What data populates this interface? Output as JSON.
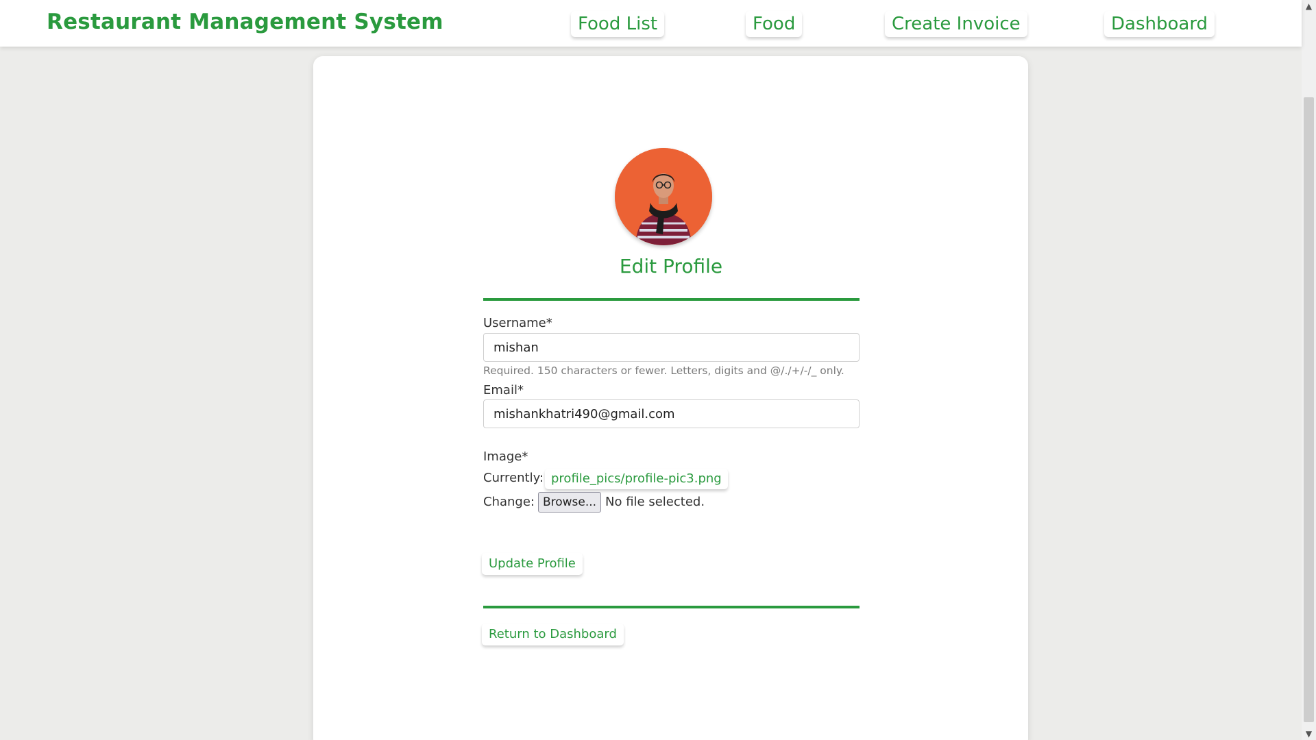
{
  "app": {
    "brand": "Restaurant Management System"
  },
  "nav": {
    "items": [
      {
        "label": "Food List"
      },
      {
        "label": "Food"
      },
      {
        "label": "Create Invoice"
      },
      {
        "label": "Dashboard"
      }
    ]
  },
  "profile": {
    "title": "Edit Profile",
    "avatar_alt": "profile picture"
  },
  "form": {
    "username_label": "Username*",
    "username_value": "mishan",
    "username_help": "Required. 150 characters or fewer. Letters, digits and @/./+/-/_ only.",
    "email_label": "Email*",
    "email_value": "mishankhatri490@gmail.com",
    "image_label": "Image*",
    "currently_label": "Currently:",
    "current_file": "profile_pics/profile-pic3.png",
    "change_label": "Change:",
    "browse_label": "Browse...",
    "no_file_text": "No file selected.",
    "submit_label": "Update Profile"
  },
  "footer": {
    "return_label": "Return to Dashboard"
  },
  "colors": {
    "accent": "#2a9a3e",
    "avatar_bg": "#ec6234",
    "page_bg": "#ececea"
  },
  "icons": {
    "scroll_up": "scroll-up-arrow-icon",
    "scroll_down": "scroll-down-arrow-icon"
  }
}
